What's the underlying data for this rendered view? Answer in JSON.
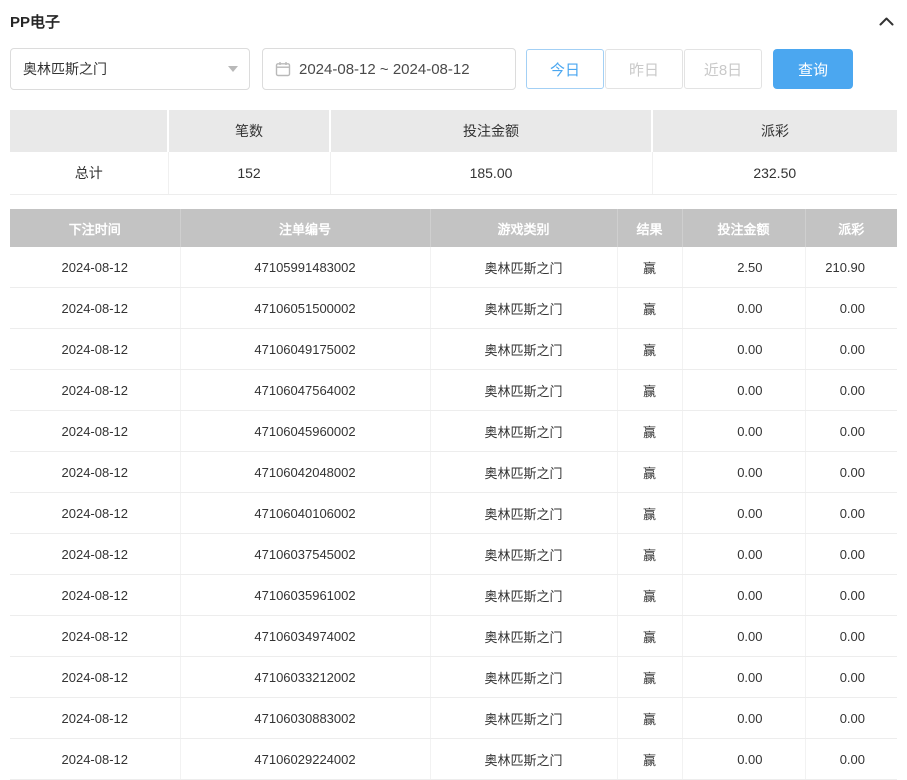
{
  "header": {
    "title": "PP电子"
  },
  "filters": {
    "game_select": {
      "value": "奥林匹斯之门"
    },
    "date_range": "2024-08-12 ~ 2024-08-12",
    "quick_buttons": [
      {
        "name": "today",
        "label": "今日",
        "active": true
      },
      {
        "name": "yesterday",
        "label": "昨日",
        "active": false
      },
      {
        "name": "last-8-days",
        "label": "近8日",
        "active": false
      }
    ],
    "search_label": "查询"
  },
  "summary": {
    "headers": [
      "",
      "笔数",
      "投注金额",
      "派彩"
    ],
    "row_label": "总计",
    "values": [
      "152",
      "185.00",
      "232.50"
    ]
  },
  "table": {
    "headers": [
      "下注时间",
      "注单编号",
      "游戏类别",
      "结果",
      "投注金额",
      "派彩"
    ],
    "rows": [
      [
        "2024-08-12",
        "47105991483002",
        "奥林匹斯之门",
        "赢",
        "2.50",
        "210.90"
      ],
      [
        "2024-08-12",
        "47106051500002",
        "奥林匹斯之门",
        "赢",
        "0.00",
        "0.00"
      ],
      [
        "2024-08-12",
        "47106049175002",
        "奥林匹斯之门",
        "赢",
        "0.00",
        "0.00"
      ],
      [
        "2024-08-12",
        "47106047564002",
        "奥林匹斯之门",
        "赢",
        "0.00",
        "0.00"
      ],
      [
        "2024-08-12",
        "47106045960002",
        "奥林匹斯之门",
        "赢",
        "0.00",
        "0.00"
      ],
      [
        "2024-08-12",
        "47106042048002",
        "奥林匹斯之门",
        "赢",
        "0.00",
        "0.00"
      ],
      [
        "2024-08-12",
        "47106040106002",
        "奥林匹斯之门",
        "赢",
        "0.00",
        "0.00"
      ],
      [
        "2024-08-12",
        "47106037545002",
        "奥林匹斯之门",
        "赢",
        "0.00",
        "0.00"
      ],
      [
        "2024-08-12",
        "47106035961002",
        "奥林匹斯之门",
        "赢",
        "0.00",
        "0.00"
      ],
      [
        "2024-08-12",
        "47106034974002",
        "奥林匹斯之门",
        "赢",
        "0.00",
        "0.00"
      ],
      [
        "2024-08-12",
        "47106033212002",
        "奥林匹斯之门",
        "赢",
        "0.00",
        "0.00"
      ],
      [
        "2024-08-12",
        "47106030883002",
        "奥林匹斯之门",
        "赢",
        "0.00",
        "0.00"
      ],
      [
        "2024-08-12",
        "47106029224002",
        "奥林匹斯之门",
        "赢",
        "0.00",
        "0.00"
      ]
    ]
  },
  "colors": {
    "accent": "#4ba7f0",
    "table_header_bg": "#c3c3c3",
    "summary_header_bg": "#e9e9e9"
  }
}
